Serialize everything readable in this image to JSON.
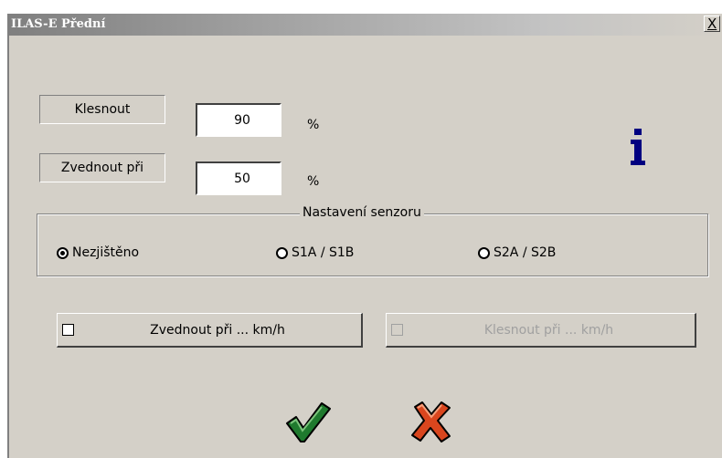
{
  "window": {
    "title": "ILAS-E Přední",
    "close_label": "X"
  },
  "fields": {
    "klesnout": {
      "label": "Klesnout",
      "value": "90",
      "unit": "%"
    },
    "zvednout": {
      "label": "Zvednout při",
      "value": "50",
      "unit": "%"
    }
  },
  "icons": {
    "info": "info-icon",
    "ok": "checkmark-icon",
    "cancel": "cross-icon"
  },
  "sensor_group": {
    "title": "Nastavení senzoru",
    "options": [
      {
        "label": "Nezjištěno",
        "selected": true
      },
      {
        "label": "S1A / S1B",
        "selected": false
      },
      {
        "label": "S2A / S2B",
        "selected": false
      }
    ]
  },
  "speed_options": [
    {
      "label": "Zvednout při ... km/h",
      "checked": false,
      "enabled": true
    },
    {
      "label": "Klesnout při ... km/h",
      "checked": false,
      "enabled": false
    }
  ],
  "colors": {
    "dialog_bg": "#d4d0c8",
    "info_icon": "#000080",
    "ok_green": "#1f7a2e",
    "cancel_red": "#d9461e"
  }
}
